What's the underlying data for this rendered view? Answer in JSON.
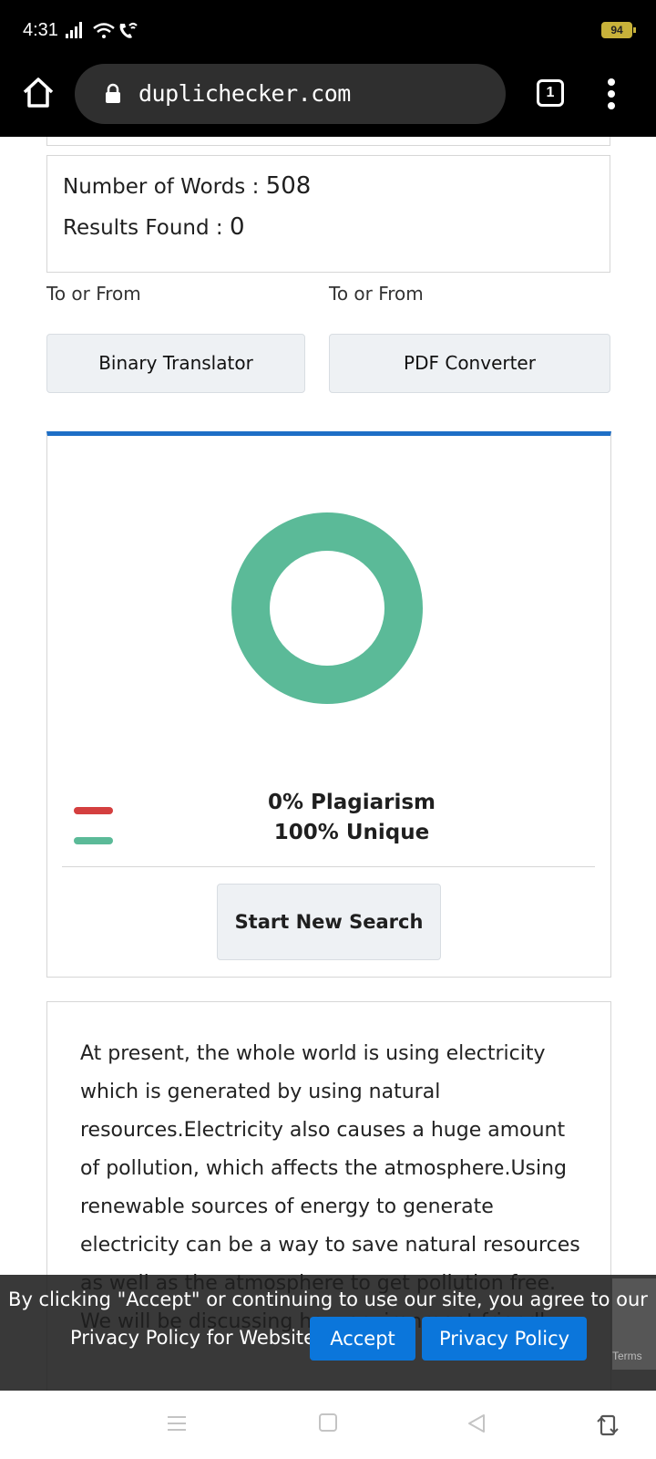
{
  "status_bar": {
    "time": "4:31",
    "battery": "94",
    "icons": [
      "signal-icon",
      "wifi-icon",
      "wifi-calling-icon"
    ]
  },
  "browser": {
    "url": "duplichecker.com",
    "tab_count": "1",
    "icons": [
      "home-icon",
      "lock-icon",
      "tabs-icon",
      "more-vert-icon"
    ]
  },
  "stats": {
    "words_label": "Number of Words : ",
    "words_value": "508",
    "results_label": "Results Found : ",
    "results_value": "0"
  },
  "tools": [
    {
      "caption": "To or From",
      "label": "Binary Translator"
    },
    {
      "caption": "To or From",
      "label": "PDF Converter"
    }
  ],
  "result": {
    "plagiarism_text": "0% Plagiarism",
    "unique_text": "100% Unique",
    "plagiarism_percent": 0,
    "unique_percent": 100,
    "new_search_label": "Start New Search"
  },
  "colors": {
    "accent_blue": "#1e6fc6",
    "plagiarism_red": "#d43f3f",
    "unique_green": "#5bba98",
    "button_blue": "#0b76db"
  },
  "content": {
    "paragraph": "At present, the whole world is using electricity which is generated by using natural resources.Electricity also causes a huge amount of pollution, which affects the atmosphere.Using renewable sources of energy to generate electricity can be a way to save natural resources as well as the atmosphere to get pollution free. We will be discussing how environment friendly"
  },
  "cookie_banner": {
    "text_line1": "By clicking \"Accept\" or continuing to use our site, you agree to our",
    "text_line2": "Privacy Policy for Website",
    "accept_label": "Accept",
    "policy_label": "Privacy Policy",
    "recaptcha_text": "Terms"
  },
  "nav_bar": {
    "icons": [
      "recent-apps-icon",
      "home-square-icon",
      "back-icon",
      "rotate-icon"
    ]
  }
}
